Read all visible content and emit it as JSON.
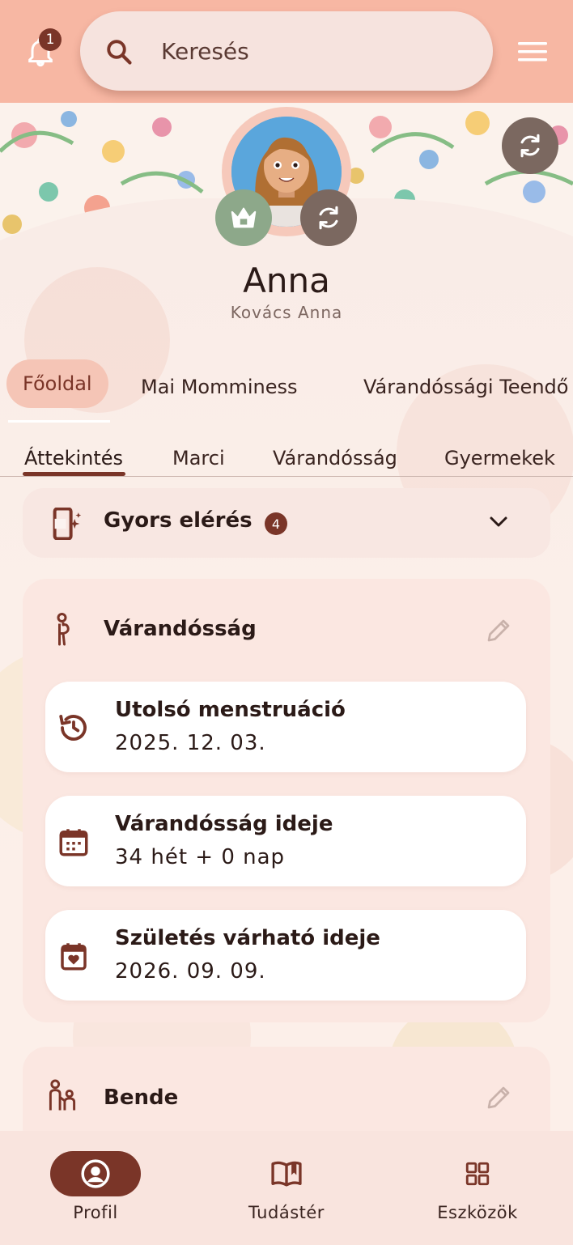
{
  "topbar": {
    "notification_count": "1",
    "search_placeholder": "Keresés"
  },
  "profile": {
    "name": "Anna",
    "full_name": "Kovács Anna"
  },
  "primary_tabs": [
    {
      "label": "Főoldal",
      "active": true
    },
    {
      "label": "Mai Momminess",
      "active": false
    },
    {
      "label": "Várandóssági Teendő",
      "active": false
    }
  ],
  "secondary_tabs": [
    {
      "label": "Áttekintés",
      "active": true
    },
    {
      "label": "Marci",
      "active": false
    },
    {
      "label": "Várandósság",
      "active": false
    },
    {
      "label": "Gyermekek",
      "active": false
    }
  ],
  "quick_access": {
    "title": "Gyors elérés",
    "count": "4"
  },
  "pregnancy_card": {
    "title": "Várandósság",
    "items": [
      {
        "icon": "history-icon",
        "title": "Utolsó menstruáció",
        "value": "2025. 12. 03."
      },
      {
        "icon": "calendar-icon",
        "title": "Várandósság ideje",
        "value": "34 hét + 0 nap"
      },
      {
        "icon": "calendar-heart-icon",
        "title": "Születés várható ideje",
        "value": "2026. 09. 09."
      }
    ]
  },
  "bende_card": {
    "title": "Bende"
  },
  "bottom_nav": [
    {
      "label": "Profil",
      "icon": "profile-icon",
      "active": true
    },
    {
      "label": "Tudástér",
      "icon": "book-icon",
      "active": false
    },
    {
      "label": "Eszközök",
      "icon": "grid-icon",
      "active": false
    }
  ],
  "colors": {
    "accent": "#7a3528",
    "topbar": "#f7b7a3",
    "active_tab": "#f5c5b6",
    "card": "#fbe7e1"
  }
}
